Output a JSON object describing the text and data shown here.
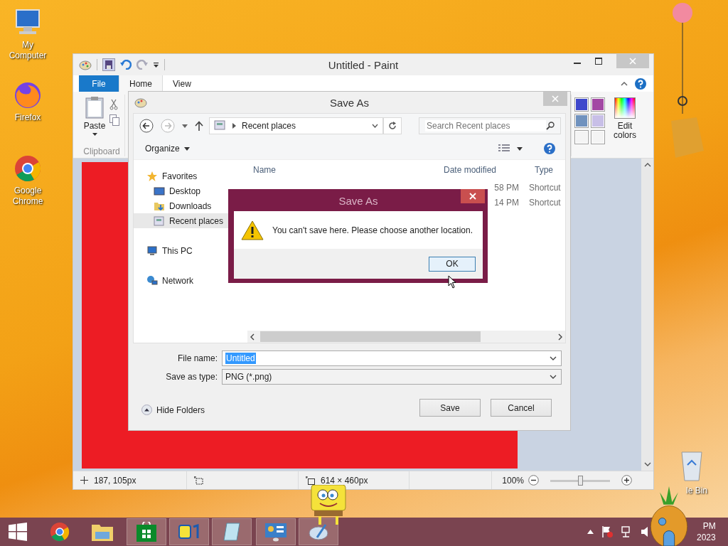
{
  "desktop_icons": [
    {
      "label": "My Computer",
      "kind": "computer"
    },
    {
      "label": "Firefox",
      "kind": "firefox"
    },
    {
      "label": "Google Chrome",
      "kind": "chrome"
    }
  ],
  "recycle_bin": {
    "label": "le Bin"
  },
  "paint": {
    "title": "Untitled - Paint",
    "tabs": [
      {
        "label": "File",
        "kind": "file",
        "selected": false
      },
      {
        "label": "Home",
        "kind": "tab",
        "selected": true
      },
      {
        "label": "View",
        "kind": "tab",
        "selected": false
      }
    ],
    "paste": "Paste",
    "group": "Clipboard",
    "edit_colors": "Edit colors",
    "palette": [
      {
        "color": "#3f48cc"
      },
      {
        "color": "#a349a4"
      },
      {
        "color": "#7092be"
      },
      {
        "color": "#c8bfe7"
      },
      {
        "color": "#f4f4f4"
      },
      {
        "color": "#f4f4f4"
      }
    ],
    "status": {
      "cursor": "187, 105px",
      "size": "614 × 460px",
      "zoom": "100%",
      "level": 0.5
    }
  },
  "save_as": {
    "title": "Save As",
    "location": "Recent places",
    "search": {
      "placeholder": "Search Recent places"
    },
    "organize": "Organize",
    "nav": [
      {
        "label": "Favorites",
        "kind": "star",
        "selected": false,
        "children": [
          {
            "label": "Desktop",
            "kind": "desktop",
            "selected": false
          },
          {
            "label": "Downloads",
            "kind": "downloads",
            "selected": false
          },
          {
            "label": "Recent places",
            "kind": "recent",
            "selected": true
          }
        ]
      },
      {
        "label": "This PC",
        "kind": "pc",
        "selected": false
      },
      {
        "label": "Network",
        "kind": "network",
        "selected": false
      }
    ],
    "columns": [
      "Name",
      "Date modified",
      "Type"
    ],
    "rows": [
      {
        "date": "58 PM",
        "type": "Shortcut"
      },
      {
        "date": "14 PM",
        "type": "Shortcut"
      }
    ],
    "file_name_label": "File name:",
    "file_name": "Untitled",
    "type_label": "Save as type:",
    "type": "PNG (*.png)",
    "hide_folders": "Hide Folders",
    "buttons": [
      "Save",
      "Cancel"
    ]
  },
  "error": {
    "title": "Save As",
    "message": "You can't save here. Please choose another location.",
    "button": "OK"
  },
  "taskbar": {
    "apps": [
      {
        "kind": "chrome",
        "running": false
      },
      {
        "kind": "explorer",
        "running": false
      },
      {
        "kind": "store",
        "running": true
      },
      {
        "kind": "sponge",
        "running": true
      },
      {
        "kind": "notepad",
        "running": true
      },
      {
        "kind": "control",
        "running": true
      },
      {
        "kind": "paint",
        "running": true
      }
    ],
    "clock": {
      "time": "PM",
      "date": "2023"
    }
  }
}
